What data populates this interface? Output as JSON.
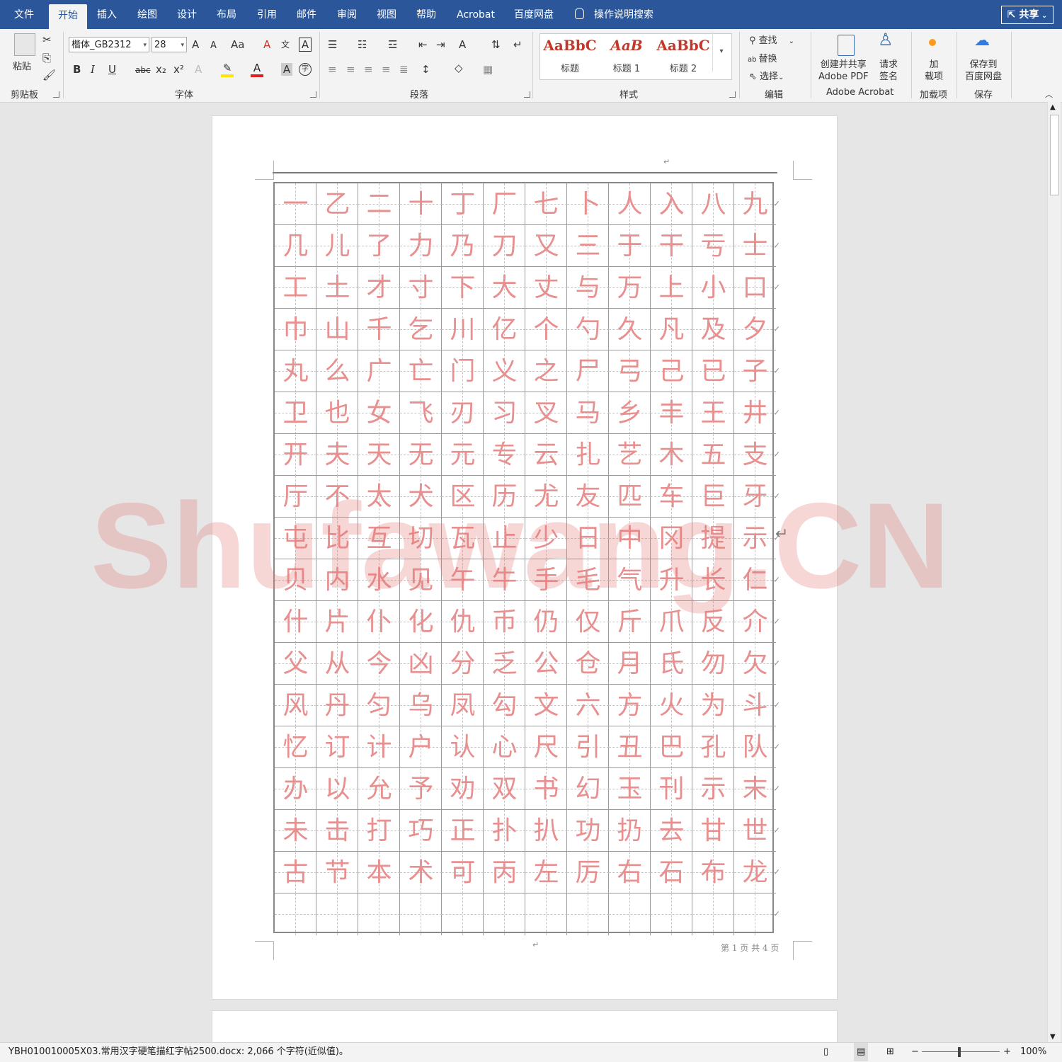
{
  "tabs": [
    "文件",
    "开始",
    "插入",
    "绘图",
    "设计",
    "布局",
    "引用",
    "邮件",
    "审阅",
    "视图",
    "帮助",
    "Acrobat",
    "百度网盘"
  ],
  "active_tab": "开始",
  "tell_me": "操作说明搜索",
  "share": "共享",
  "ribbon": {
    "clipboard": {
      "paste": "粘贴",
      "label": "剪贴板"
    },
    "font": {
      "name": "楷体_GB2312",
      "size": "28",
      "label": "字体",
      "bold": "B",
      "italic": "I",
      "underline": "U",
      "strike": "abc",
      "sub": "x₂",
      "sup": "x²",
      "grow": "A",
      "shrink": "A",
      "case": "Aa",
      "color_letter": "A"
    },
    "paragraph": {
      "label": "段落"
    },
    "styles": {
      "label": "样式",
      "items": [
        {
          "preview": "AaBbC",
          "name": "标题"
        },
        {
          "preview": "AaB",
          "name": "标题 1"
        },
        {
          "preview": "AaBbC",
          "name": "标题 2"
        }
      ]
    },
    "editing": {
      "find": "查找",
      "replace": "替换",
      "select": "选择",
      "label": "编辑"
    },
    "acrobat": {
      "create": "创建并共享",
      "create2": "Adobe PDF",
      "sign": "请求",
      "sign2": "签名",
      "label": "Adobe Acrobat"
    },
    "addins": {
      "btn": "加",
      "btn2": "载项",
      "label": "加载项"
    },
    "save": {
      "btn": "保存到",
      "btn2": "百度网盘",
      "label": "保存"
    }
  },
  "grid_chars": "一乙二十丁厂七卜人入八九几儿了力乃刀又三于干亏士工土才寸下大丈与万上小口巾山千乞川亿个勺久凡及夕丸么广亡门义之尸弓己已子卫也女飞刃习叉马乡丰王井开夫天无元专云扎艺木五支厅不太犬区历尤友匹车巨牙屯比互切瓦止少日中冈提示贝内水见午牛手毛气升长仁什片仆化仇币仍仅斤爪反介父从今凶分乏公仓月氏勿欠风丹匀乌凤勾文六方火为斗忆订计户认心尺引丑巴孔队办以允予劝双书幻玉刊示末未击打巧正扑扒功扔去甘世古节本术可丙左厉右石布龙",
  "footer": "第 1 页 共 4 页",
  "watermark": "Shufawang.CN",
  "status": {
    "doc": "YBH010010005X03.常用汉字硬笔描红字帖2500.docx: 2,066 个字符(近似值)。",
    "zoom": "100%"
  },
  "colors": {
    "title_bar": "#2b579a",
    "trace_char": "#e88f8f"
  }
}
